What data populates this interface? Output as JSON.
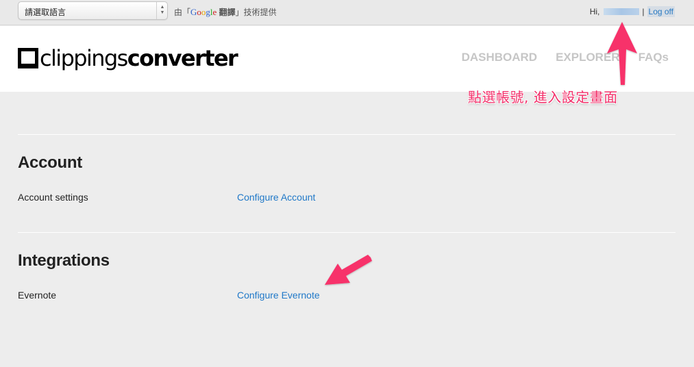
{
  "translate_bar": {
    "language_select": {
      "value": "請選取語言",
      "arrows_glyph": "▲▼"
    },
    "powered_by": {
      "prefix": "由「",
      "google_letters": [
        "G",
        "o",
        "o",
        "g",
        "l",
        "e"
      ],
      "translate_word": " 翻譯",
      "suffix": "」技術提供"
    }
  },
  "user": {
    "greeting": "Hi,",
    "separator": "|",
    "logoff_label": "Log off"
  },
  "header": {
    "logo": {
      "light": "clippings",
      "bold": "converter"
    },
    "nav": [
      {
        "label": "DASHBOARD"
      },
      {
        "label": "EXPLORER"
      },
      {
        "label": "FAQs"
      }
    ]
  },
  "sections": [
    {
      "title": "Account",
      "row_label": "Account settings",
      "link_label": "Configure Account"
    },
    {
      "title": "Integrations",
      "row_label": "Evernote",
      "link_label": "Configure Evernote"
    }
  ],
  "annotations": {
    "text": "點選帳號, 進入設定畫面",
    "color": "#f2306a"
  },
  "colors": {
    "link": "#1f78c8",
    "nav": "#c6c6c6",
    "background": "#ededed",
    "annotation": "#f2306a"
  }
}
